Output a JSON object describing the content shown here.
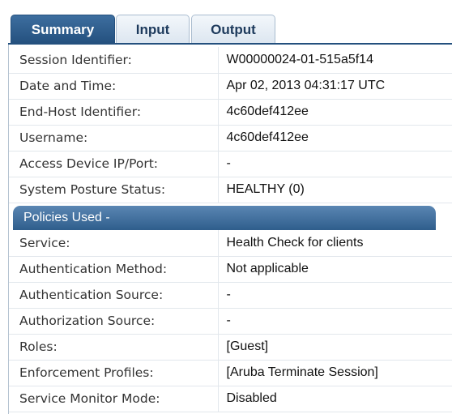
{
  "tabs": [
    {
      "label": "Summary",
      "active": true
    },
    {
      "label": "Input",
      "active": false
    },
    {
      "label": "Output",
      "active": false
    }
  ],
  "summary": [
    {
      "label": "Session Identifier:",
      "value": "W00000024-01-515a5f14"
    },
    {
      "label": "Date and Time:",
      "value": "Apr 02, 2013 04:31:17 UTC"
    },
    {
      "label": "End-Host Identifier:",
      "value": "4c60def412ee"
    },
    {
      "label": "Username:",
      "value": "4c60def412ee"
    },
    {
      "label": "Access Device IP/Port:",
      "value": "-"
    },
    {
      "label": "System Posture Status:",
      "value": "HEALTHY (0)"
    }
  ],
  "policies": {
    "header": "Policies Used -",
    "rows": [
      {
        "label": "Service:",
        "value": "Health Check for clients"
      },
      {
        "label": "Authentication Method:",
        "value": "Not applicable"
      },
      {
        "label": "Authentication Source:",
        "value": "-"
      },
      {
        "label": "Authorization Source:",
        "value": "-"
      },
      {
        "label": "Roles:",
        "value": "[Guest]"
      },
      {
        "label": "Enforcement Profiles:",
        "value": "[Aruba Terminate Session]"
      },
      {
        "label": "Service Monitor Mode:",
        "value": "Disabled"
      }
    ]
  },
  "colors": {
    "tab_active": "#24507e",
    "section_header": "#3f6c99"
  }
}
